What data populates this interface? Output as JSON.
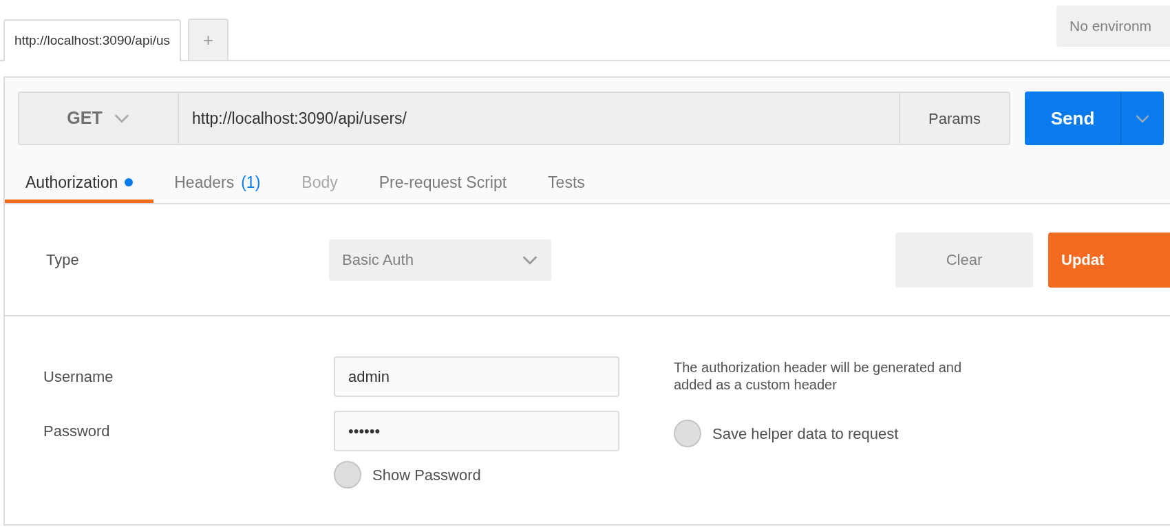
{
  "request_tabs": [
    {
      "label": "http://localhost:3090/api/us",
      "selected": true
    }
  ],
  "new_tab_button": "+",
  "environment": {
    "value": "No environm"
  },
  "request": {
    "method": "GET",
    "url": "http://localhost:3090/api/users/",
    "params_button": "Params",
    "send_button": "Send"
  },
  "tabs": [
    {
      "label": "Authorization",
      "selected": true,
      "indicator": true,
      "disabled": false
    },
    {
      "label": "Headers",
      "count": "(1)",
      "selected": false,
      "indicator": false,
      "disabled": false
    },
    {
      "label": "Body",
      "selected": false,
      "indicator": false,
      "disabled": true
    },
    {
      "label": "Pre-request Script",
      "selected": false,
      "indicator": false,
      "disabled": false
    },
    {
      "label": "Tests",
      "selected": false,
      "indicator": false,
      "disabled": false
    }
  ],
  "auth": {
    "type_label": "Type",
    "type_value": "Basic Auth",
    "clear_button": "Clear",
    "update_button": "Updat",
    "fields": [
      {
        "label": "Username",
        "value": "admin"
      },
      {
        "label": "Password",
        "value": "••••••"
      }
    ],
    "show_password": {
      "label": "Show Password",
      "checked": false
    },
    "helper_note": "The authorization header will be generated and added as a custom header",
    "save_helper": {
      "label": "Save helper data to request",
      "checked": false
    }
  }
}
